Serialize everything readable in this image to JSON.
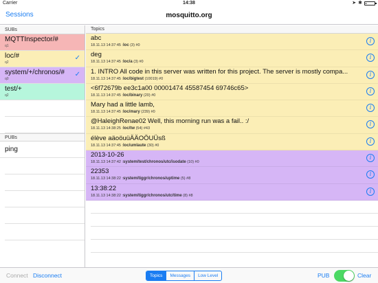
{
  "status_bar": {
    "carrier": "Carrier",
    "time": "14:38",
    "battery_level": 0.1
  },
  "nav": {
    "back_label": "Sessions",
    "title": "mosquitto.org"
  },
  "subs": {
    "header": "SUBs",
    "items": [
      {
        "topic": "MQTTInspector/#",
        "qos": "q1",
        "checked": false,
        "color": "#f6b6b6"
      },
      {
        "topic": "loc/#",
        "qos": "q2",
        "checked": true,
        "color": "#fbeeb6"
      },
      {
        "topic": "system/+/chronos/#",
        "qos": "q0",
        "checked": true,
        "color": "#d6b6f6"
      },
      {
        "topic": "test/+",
        "qos": "q2",
        "checked": false,
        "color": "#b6f6dc"
      }
    ],
    "check_glyph": "✓"
  },
  "pubs": {
    "header": "PUBs",
    "items": [
      {
        "label": "ping"
      }
    ]
  },
  "topics": {
    "header": "Topics",
    "messages": [
      {
        "text": "abc",
        "timestamp": "18.11.13 14:37:45",
        "topic": "loc",
        "info": "(3) #0",
        "color": "#fbeeb6"
      },
      {
        "text": "deg",
        "timestamp": "18.11.13 14:37:45",
        "topic": "loc/a",
        "info": "(3) #0",
        "color": "#fbeeb6"
      },
      {
        "text": "1. INTRO All code in this server was written for this project.  The server is mostly compa...",
        "timestamp": "18.11.13 14:37:45",
        "topic": "loc/bigtest",
        "info": "(10019) #0",
        "color": "#fbeeb6"
      },
      {
        "text": "<6f72679b ee3c1a00 00001474 45587454 69746c65>",
        "timestamp": "18.11.13 14:37:45",
        "topic": "loc/binary",
        "info": "(20) #0",
        "color": "#fbeeb6"
      },
      {
        "text": "Mary had a little lamb,",
        "timestamp": "18.11.13 14:37:45",
        "topic": "loc/mary",
        "info": "(239) #0",
        "color": "#fbeeb6"
      },
      {
        "text": "@HaleighRenae02 Well, this morning run was a fail.. :/",
        "timestamp": "18.11.13 14:38:25",
        "topic": "loc/tw",
        "info": "(54) #43",
        "color": "#fbeeb6"
      },
      {
        "text": "élève aäoöuüÄÄOÖUÜsß",
        "timestamp": "18.11.13 14:37:45",
        "topic": "loc/umlaute",
        "info": "(30) #0",
        "color": "#fbeeb6"
      },
      {
        "text": "2013-10-26",
        "timestamp": "18.11.13 14:37:42",
        "topic": "system/test/chronos/utc/isodate",
        "info": "(10) #0",
        "color": "#d6b6f6"
      },
      {
        "text": "22353",
        "timestamp": "18.11.13 14:38:22",
        "topic": "system/tiggr/chronos/uptime",
        "info": "(5) #8",
        "color": "#d6b6f6"
      },
      {
        "text": "13:38:22",
        "timestamp": "18.11.13 14:38:22",
        "topic": "system/tiggr/chronos/utc/time",
        "info": "(8) #8",
        "color": "#d6b6f6"
      }
    ],
    "info_glyph": "i"
  },
  "toolbar": {
    "connect_label": "Connect",
    "disconnect_label": "Disconnect",
    "segments": [
      {
        "label": "Topics",
        "active": true
      },
      {
        "label": "Messages",
        "active": false
      },
      {
        "label": "Low Level",
        "active": false
      }
    ],
    "pub_label": "PUB",
    "pub_toggle_on": true,
    "clear_label": "Clear"
  }
}
